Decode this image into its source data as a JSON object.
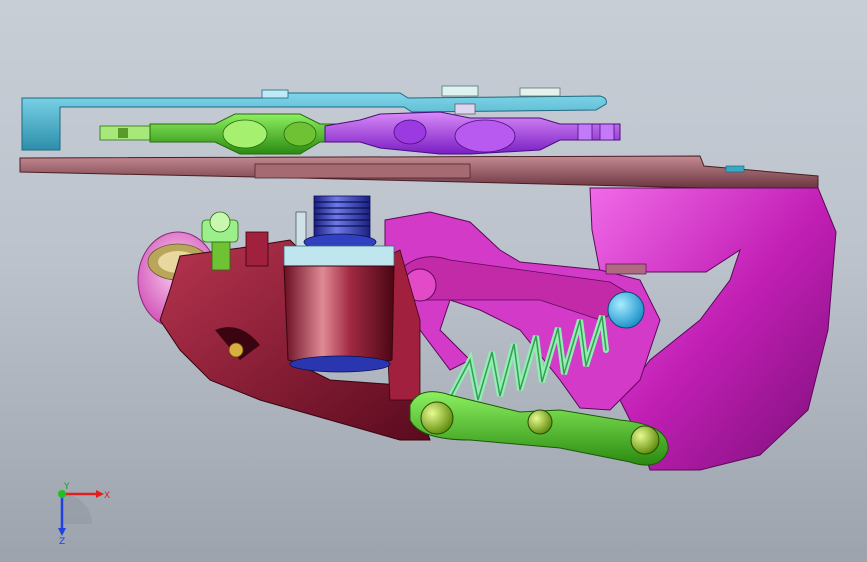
{
  "window": {
    "background_top": "#c7ced6",
    "background_bottom": "#9ca3ad"
  },
  "model": {
    "parts": [
      {
        "name": "upper-link-plate",
        "color": "#39a8c4"
      },
      {
        "name": "lower-base-plate",
        "color": "#8a4a52"
      },
      {
        "name": "left-chain-assembly",
        "color": "#6ec234"
      },
      {
        "name": "right-chain-assembly",
        "color": "#a43df0"
      },
      {
        "name": "main-housing",
        "color": "#c21fb5"
      },
      {
        "name": "left-body",
        "color": "#8a1230"
      },
      {
        "name": "cylinder-cap",
        "color": "#2a36b0"
      },
      {
        "name": "compression-spring",
        "color": "#8ff0b0"
      },
      {
        "name": "green-link-arm",
        "color": "#48d018"
      },
      {
        "name": "pink-disc",
        "color": "#f07ad8"
      }
    ],
    "pivot_accent": "#2ab8f0"
  },
  "triad": {
    "x_label": "X",
    "y_label": "Y",
    "z_label": "Z",
    "x_color": "#e02020",
    "y_color": "#20c020",
    "z_color": "#2040e0"
  }
}
